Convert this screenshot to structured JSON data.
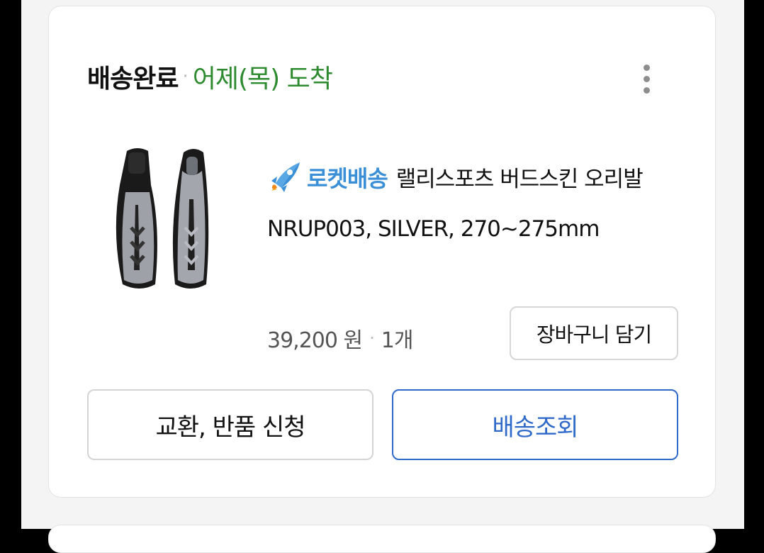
{
  "order": {
    "status": "배송완료",
    "separator": "·",
    "arrival": "어제(목) 도착"
  },
  "product": {
    "badge": "로켓배송",
    "name": "랠리스포츠 버드스킨 오리발 NRUP003, SILVER, 270~275mm",
    "price": "39,200 원",
    "quantity": "1개"
  },
  "actions": {
    "add_to_cart": "장바구니 담기",
    "return_exchange": "교환, 반품 신청",
    "track_delivery": "배송조회"
  },
  "icons": {
    "more": "more-vertical-icon",
    "rocket": "rocket-icon"
  },
  "colors": {
    "arrival_green": "#2e8a2e",
    "rocket_blue": "#3b8fd6",
    "primary_blue": "#2f69c9"
  }
}
